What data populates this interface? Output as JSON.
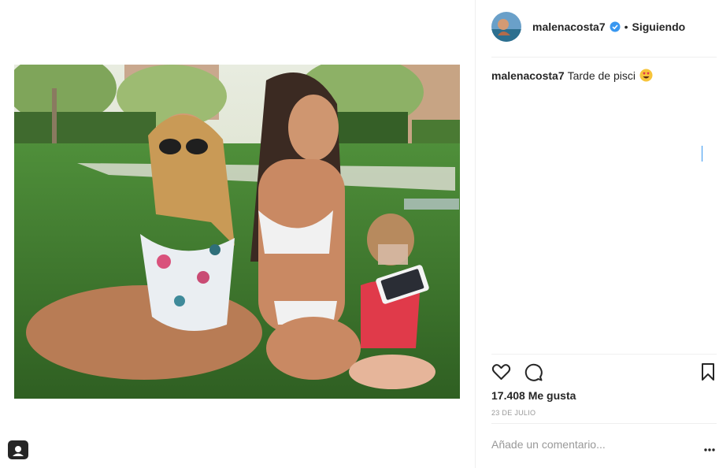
{
  "post": {
    "username": "malenacosta7",
    "follow_state": "Siguiendo",
    "separator": "•",
    "caption_user": "malenacosta7",
    "caption_text": "Tarde de pisci",
    "caption_emoji": "heart-eyes-emoji",
    "likes": "17.408 Me gusta",
    "date": "23 DE JULIO",
    "comment_placeholder": "Añade un comentario..."
  },
  "icons": {
    "like": "heart-icon",
    "comment": "comment-icon",
    "save": "bookmark-icon",
    "verified": "verified-badge-icon",
    "more": "more-options-icon",
    "user_tag": "user-tag-icon"
  },
  "colors": {
    "text": "#262626",
    "muted": "#999999",
    "verified": "#3897f0",
    "divider": "#efefef"
  }
}
